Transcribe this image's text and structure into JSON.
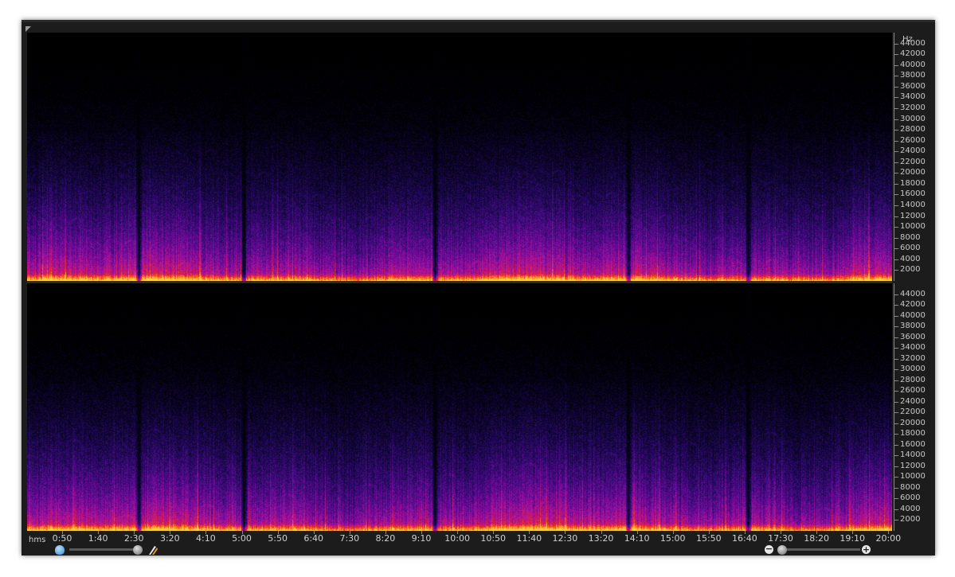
{
  "window": {
    "background": "#1c1c1c"
  },
  "colormap": [
    "#000000",
    "#0a0426",
    "#2a0a6a",
    "#6a0a9a",
    "#b0129a",
    "#e0203e",
    "#ff6a10",
    "#ffd040"
  ],
  "frequency_axis": {
    "unit": "Hz",
    "max": 46000,
    "labels": [
      "44000",
      "42000",
      "40000",
      "38000",
      "36000",
      "34000",
      "32000",
      "30000",
      "28000",
      "26000",
      "24000",
      "22000",
      "20000",
      "18000",
      "16000",
      "14000",
      "12000",
      "10000",
      "8000",
      "6000",
      "4000",
      "2000"
    ]
  },
  "time_axis": {
    "format": "hms",
    "labels": [
      "0:50",
      "1:40",
      "2:30",
      "3:20",
      "4:10",
      "5:00",
      "5:50",
      "6:40",
      "7:30",
      "8:20",
      "9:10",
      "10:00",
      "10:50",
      "11:40",
      "12:30",
      "13:20",
      "14:10",
      "15:00",
      "15:50",
      "16:40",
      "17:30",
      "18:20",
      "19:10",
      "20:00"
    ]
  },
  "controls": {
    "zoom_out_symbol": "−",
    "zoom_in_symbol": "+",
    "icons": [
      "hand-icon",
      "snap-icon",
      "zoom-out-icon",
      "zoom-in-icon"
    ]
  }
}
